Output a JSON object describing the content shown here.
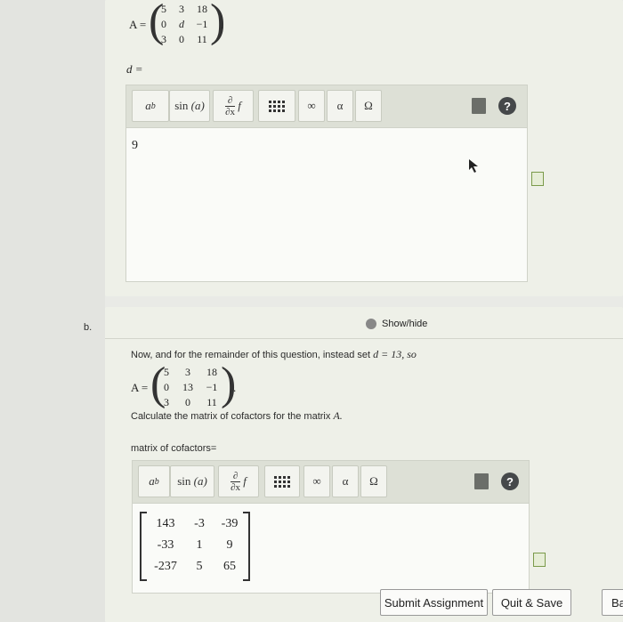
{
  "part_a": {
    "matrix_lhs": "A =",
    "matrix": [
      [
        "5",
        "3",
        "18"
      ],
      [
        "0",
        "d",
        "−1"
      ],
      [
        "3",
        "0",
        "11"
      ]
    ],
    "period": ".",
    "answer_label": "d =",
    "answer_value": "9"
  },
  "toolbar": {
    "power": "a",
    "power_sup": "b",
    "sin": "sin",
    "sin_arg": "(a)",
    "deriv_top": "∂",
    "deriv_bottom": "∂x",
    "deriv_f": "f",
    "infinity": "∞",
    "alpha": "α",
    "omega": "Ω",
    "help": "?"
  },
  "part_b": {
    "label": "b.",
    "show_hide": "Show/hide",
    "intro_text": "Now, and for the remainder of this question, instead set",
    "intro_eq": "d = 13, so",
    "matrix_lhs": "A =",
    "matrix": [
      [
        "5",
        "3",
        "18"
      ],
      [
        "0",
        "13",
        "−1"
      ],
      [
        "3",
        "0",
        "11"
      ]
    ],
    "period": ".",
    "instruction": "Calculate the matrix of cofactors for the matrix",
    "instruction_var": "A.",
    "answer_label": "matrix of cofactors=",
    "cofactors": [
      [
        "143",
        "-3",
        "-39"
      ],
      [
        "-33",
        "1",
        "9"
      ],
      [
        "-237",
        "5",
        "65"
      ]
    ]
  },
  "footer": {
    "submit": "Submit Assignment",
    "quit": "Quit & Save",
    "back": "Ba"
  }
}
